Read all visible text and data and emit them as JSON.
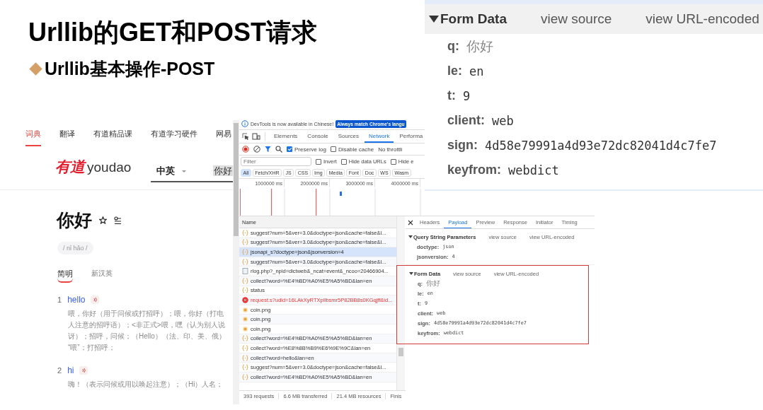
{
  "slide": {
    "title": "Urllib的GET和POST请求",
    "subtitle": "Urllib基本操作-POST"
  },
  "youdao": {
    "nav": [
      {
        "label": "词典",
        "selected": true
      },
      {
        "label": "翻译",
        "selected": false
      },
      {
        "label": "有道精品课",
        "selected": false
      },
      {
        "label": "有道学习硬件",
        "selected": false
      },
      {
        "label": "网易",
        "selected": false
      }
    ],
    "logo_cn": "有道",
    "logo_en": "youdao",
    "language": "中英",
    "search_value": "你好",
    "word": "你好",
    "pinyin": "/ nǐ hǎo /",
    "tabs": [
      {
        "label": "简明",
        "selected": true
      },
      {
        "label": "新汉英",
        "selected": false
      }
    ],
    "entries": [
      {
        "number": "1",
        "word": "hello",
        "lines": [
          "喂，你好（用于问候或打招呼）；喂，你好（打电",
          "人注意的招呼语）；<非正式>喂，嘿（认为别人说",
          "讶）；招呼，问候；（Hello）（法、印、美、俄）",
          "“喂”；打招呼；"
        ]
      },
      {
        "number": "2",
        "word": "hi",
        "lines": [
          "嗨！（表示问候或用以唤起注意）；（Hi）人名；"
        ]
      }
    ]
  },
  "devtools": {
    "info_message": "DevTools is now available in Chinese!",
    "info_button": "Always match Chrome's langu",
    "tabs": [
      {
        "label": "Elements",
        "selected": false
      },
      {
        "label": "Console",
        "selected": false
      },
      {
        "label": "Sources",
        "selected": false
      },
      {
        "label": "Network",
        "selected": true
      },
      {
        "label": "Performa",
        "selected": false
      }
    ],
    "toolbar_options": [
      {
        "label": "Preserve log",
        "checked": true
      },
      {
        "label": "Disable cache",
        "checked": false
      }
    ],
    "throttling": "No throttli",
    "filter": {
      "placeholder": "Filter"
    },
    "filter_options": [
      {
        "label": "Invert",
        "checked": false
      },
      {
        "label": "Hide data URLs",
        "checked": false
      },
      {
        "label": "Hide e",
        "checked": false
      }
    ],
    "type_filters": [
      {
        "label": "All",
        "selected": true
      },
      {
        "label": "Fetch/XHR",
        "selected": false
      },
      {
        "label": "JS",
        "selected": false
      },
      {
        "label": "CSS",
        "selected": false
      },
      {
        "label": "Img",
        "selected": false
      },
      {
        "label": "Media",
        "selected": false
      },
      {
        "label": "Font",
        "selected": false
      },
      {
        "label": "Doc",
        "selected": false
      },
      {
        "label": "WS",
        "selected": false
      },
      {
        "label": "Wasm",
        "selected": false
      }
    ],
    "timeline_ticks": [
      "1000000 ms",
      "2000000 ms",
      "3000000 ms",
      "4000000 ms"
    ],
    "requests_column": "Name",
    "requests": [
      {
        "kind": "xhr",
        "name": "suggest?num=5&ver=3.0&doctype=json&cache=false&l...",
        "selected": false
      },
      {
        "kind": "xhr",
        "name": "suggest?num=5&ver=3.0&doctype=json&cache=false&l...",
        "selected": false
      },
      {
        "kind": "xhr",
        "name": "jsonapi_s?doctype=json&jsonversion=4",
        "selected": true
      },
      {
        "kind": "xhr",
        "name": "suggest?num=5&ver=3.0&doctype=json&cache=false&l...",
        "selected": false
      },
      {
        "kind": "doc",
        "name": "rlog.php?_npid=dictweb&_ncat=event&_ncoo=20466904...",
        "selected": false
      },
      {
        "kind": "xhr",
        "name": "collect?word=%E4%BD%A0%E5%A5%BD&lan=en",
        "selected": false
      },
      {
        "kind": "xhr",
        "name": "status",
        "selected": false
      },
      {
        "kind": "error",
        "name": "request.s?udid=16LAkXyRTXpIlbsmr5P82BB8s0KGqjff&id...",
        "selected": false
      },
      {
        "kind": "image",
        "name": "coin.png",
        "selected": false
      },
      {
        "kind": "image",
        "name": "coin.png",
        "selected": false
      },
      {
        "kind": "image",
        "name": "coin.png",
        "selected": false
      },
      {
        "kind": "xhr",
        "name": "collect?word=%E4%BD%A0%E5%A5%BD&lan=en",
        "selected": false
      },
      {
        "kind": "xhr",
        "name": "collect?word=%E8%8B%B9%E6%9E%9C&lan=en",
        "selected": false
      },
      {
        "kind": "xhr",
        "name": "collect?word=hello&lan=en",
        "selected": false
      },
      {
        "kind": "xhr",
        "name": "suggest?num=5&ver=3.0&doctype=json&cache=false&l...",
        "selected": false
      },
      {
        "kind": "xhr",
        "name": "collect?word=%E4%BD%A0%E5%A5%BD&lan=en",
        "selected": false
      }
    ],
    "status_bar": [
      "393 requests",
      "6.6 MB transferred",
      "21.4 MB resources",
      "Finis"
    ],
    "detail_tabs": [
      {
        "label": "Headers",
        "selected": false
      },
      {
        "label": "Payload",
        "selected": true
      },
      {
        "label": "Preview",
        "selected": false
      },
      {
        "label": "Response",
        "selected": false
      },
      {
        "label": "Initiator",
        "selected": false
      },
      {
        "label": "Timing",
        "selected": false
      }
    ],
    "sections": [
      {
        "title": "Query String Parameters",
        "view_source": "view source",
        "view_encoded": "view URL-encoded",
        "highlighted": false,
        "params": [
          {
            "key": "doctype:",
            "value": "json"
          },
          {
            "key": "jsonversion:",
            "value": "4"
          }
        ]
      },
      {
        "title": "Form Data",
        "view_source": "view source",
        "view_encoded": "view URL-encoded",
        "highlighted": true,
        "params": [
          {
            "key": "q:",
            "value": "你好"
          },
          {
            "key": "le:",
            "value": "en"
          },
          {
            "key": "t:",
            "value": "9"
          },
          {
            "key": "client:",
            "value": "web"
          },
          {
            "key": "sign:",
            "value": "4d58e79991a4d93e72dc82041d4c7fe7"
          },
          {
            "key": "keyfrom:",
            "value": "webdict"
          }
        ]
      }
    ]
  },
  "zoomed_form_data": {
    "title": "Form Data",
    "view_source": "view source",
    "view_encoded": "view URL-encoded",
    "params": [
      {
        "key": "q:",
        "value": "你好"
      },
      {
        "key": "le:",
        "value": "en"
      },
      {
        "key": "t:",
        "value": "9"
      },
      {
        "key": "client:",
        "value": "web"
      },
      {
        "key": "sign:",
        "value": "4d58e79991a4d93e72dc82041d4c7fe7"
      },
      {
        "key": "keyfrom:",
        "value": "webdict"
      }
    ]
  }
}
